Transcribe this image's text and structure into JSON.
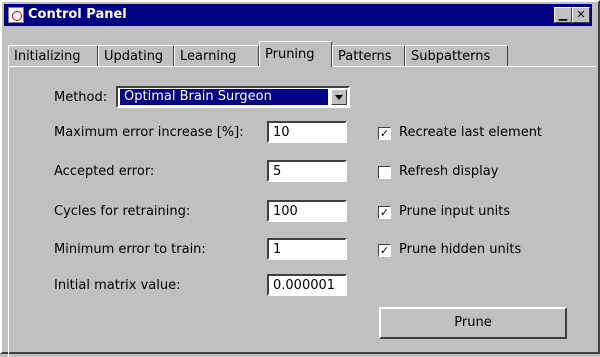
{
  "window": {
    "title": "Control Panel",
    "minimize_glyph": "▁",
    "close_glyph": "✕"
  },
  "tabs": [
    "Initializing",
    "Updating",
    "Learning",
    "Pruning",
    "Patterns",
    "Subpatterns"
  ],
  "active_tab": "Pruning",
  "form": {
    "method_label": "Method:",
    "method_value": "Optimal Brain Surgeon",
    "fields": [
      {
        "label": "Maximum error increase [%]:",
        "value": "10"
      },
      {
        "label": "Accepted error:",
        "value": "5"
      },
      {
        "label": "Cycles for retraining:",
        "value": "100"
      },
      {
        "label": "Minimum error to train:",
        "value": "1"
      },
      {
        "label": "Initial matrix value:",
        "value": "0.000001"
      }
    ],
    "options": [
      {
        "label": "Recreate last element",
        "checked": true
      },
      {
        "label": "Refresh display",
        "checked": false
      },
      {
        "label": "Prune input units",
        "checked": true
      },
      {
        "label": "Prune hidden units",
        "checked": true
      }
    ],
    "prune_button_label": "Prune"
  }
}
